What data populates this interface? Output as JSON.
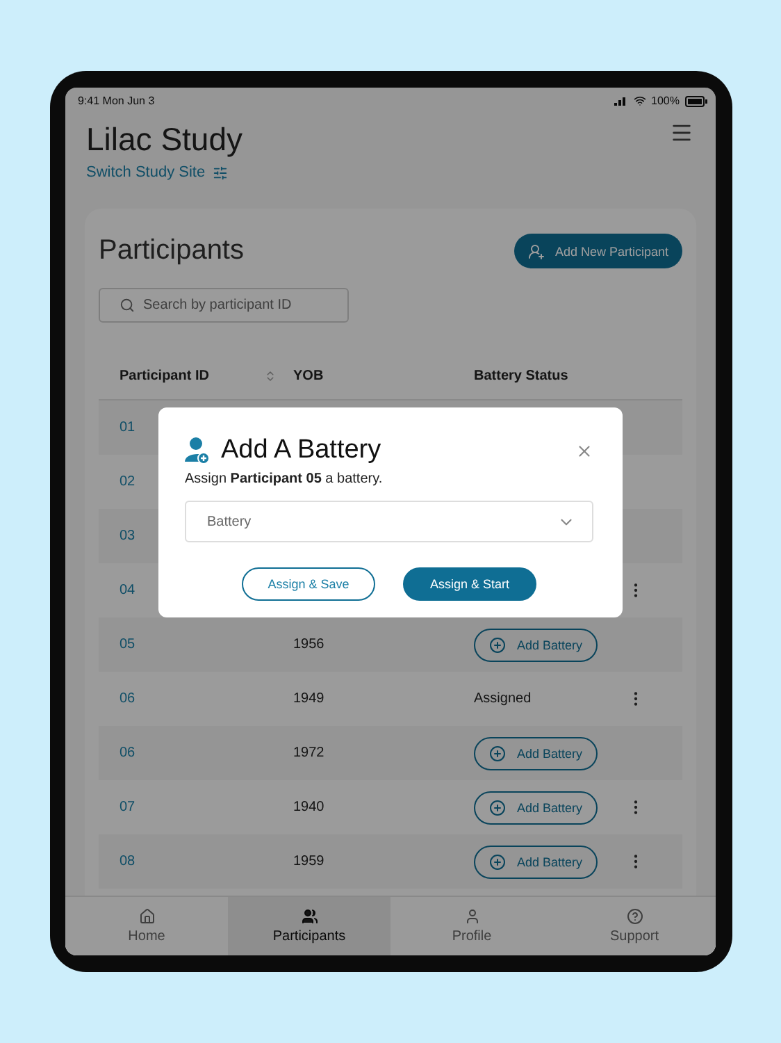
{
  "status_bar": {
    "time": "9:41 Mon Jun 3",
    "battery": "100%"
  },
  "header": {
    "title": "Lilac Study",
    "switch_link": "Switch Study Site"
  },
  "participants": {
    "title": "Participants",
    "add_button": "Add New Participant",
    "search": {
      "placeholder": "Search by participant ID"
    },
    "columns": [
      "Participant ID",
      "YOB",
      "Battery Status"
    ],
    "rows": [
      {
        "id": "01",
        "has_menu": false
      },
      {
        "id": "02",
        "has_menu": false
      },
      {
        "id": "03",
        "has_menu": false
      },
      {
        "id": "04",
        "has_menu": true
      },
      {
        "id": "05",
        "yob": "1956",
        "status": {
          "kind": "button",
          "label": "Add Battery"
        },
        "has_menu": false
      },
      {
        "id": "06",
        "yob": "1949",
        "status": {
          "kind": "text",
          "label": "Assigned"
        },
        "has_menu": true
      },
      {
        "id": "06",
        "yob": "1972",
        "status": {
          "kind": "button",
          "label": "Add Battery"
        },
        "has_menu": false
      },
      {
        "id": "07",
        "yob": "1940",
        "status": {
          "kind": "button",
          "label": "Add Battery"
        },
        "has_menu": true
      },
      {
        "id": "08",
        "yob": "1959",
        "status": {
          "kind": "button",
          "label": "Add Battery"
        },
        "has_menu": true
      }
    ]
  },
  "tabs": [
    {
      "label": "Home",
      "selected": false
    },
    {
      "label": "Participants",
      "selected": true
    },
    {
      "label": "Profile",
      "selected": false
    },
    {
      "label": "Support",
      "selected": false
    }
  ],
  "dialog": {
    "title": "Add A Battery",
    "message": "Assign **Participant 05** a battery.",
    "select": {
      "placeholder": "Battery"
    },
    "buttons": [
      {
        "label": "Assign & Save",
        "kind": "outline"
      },
      {
        "label": "Assign & Start",
        "kind": "primary"
      }
    ]
  }
}
